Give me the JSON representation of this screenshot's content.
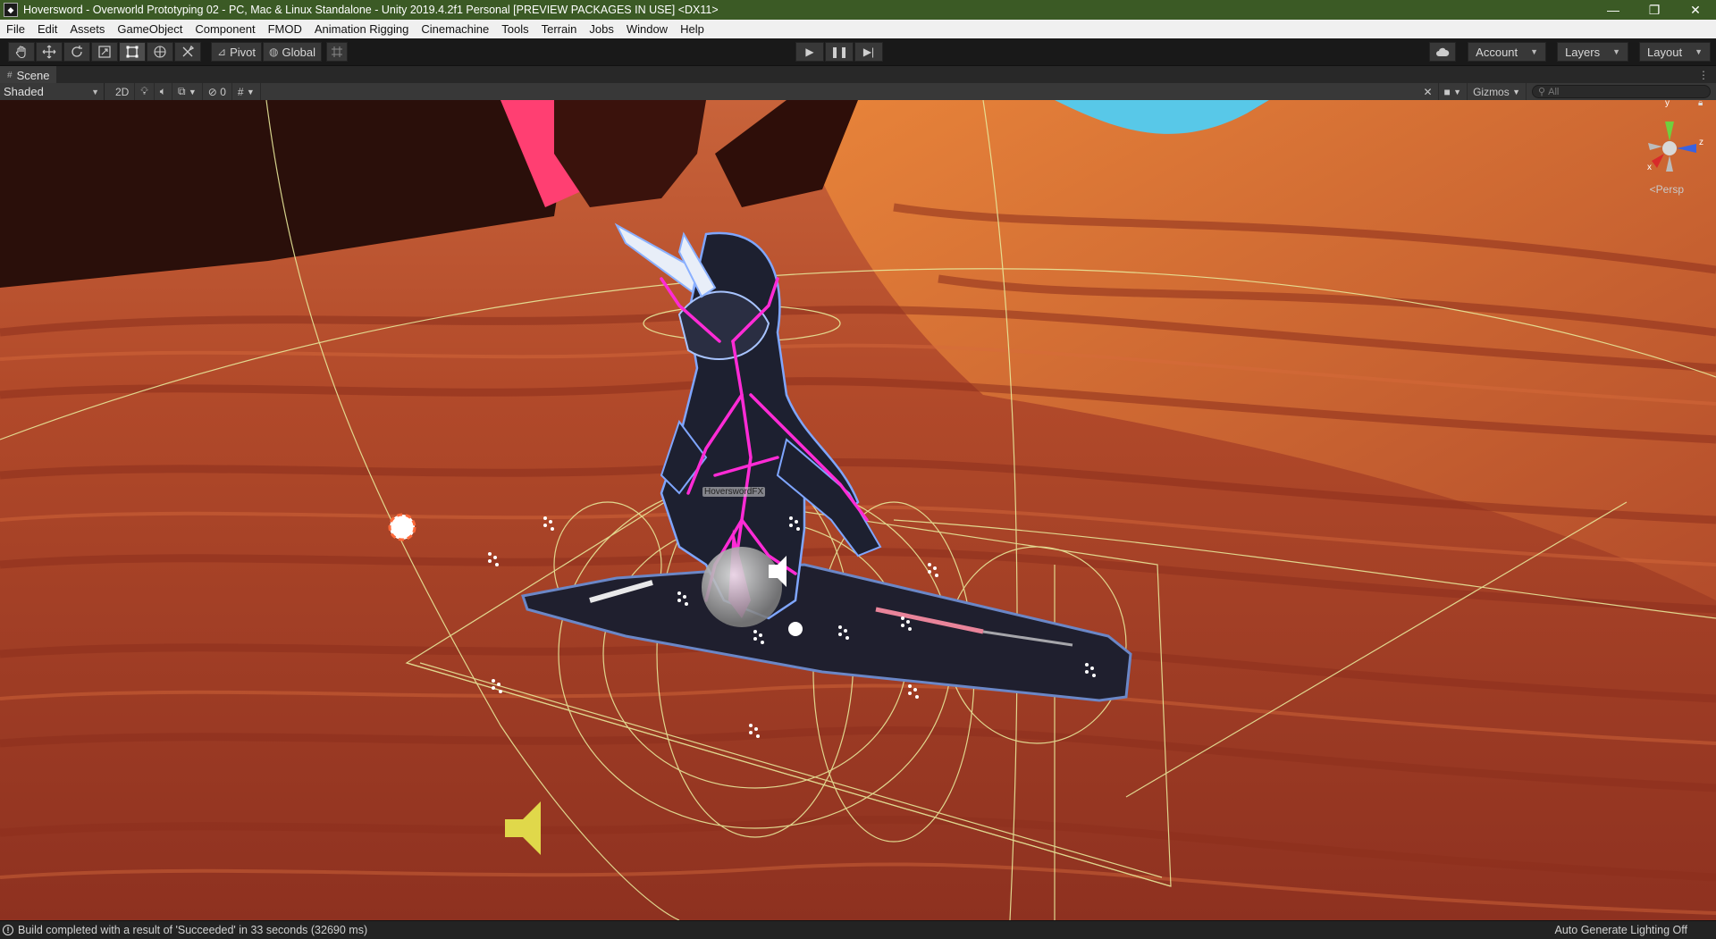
{
  "titlebar": {
    "title": "Hoversword - Overworld Prototyping 02 - PC, Mac & Linux Standalone - Unity 2019.4.2f1 Personal [PREVIEW PACKAGES IN USE] <DX11>",
    "minimize": "—",
    "maximize": "❐",
    "close": "✕"
  },
  "menu": [
    "File",
    "Edit",
    "Assets",
    "GameObject",
    "Component",
    "FMOD",
    "Animation Rigging",
    "Cinemachine",
    "Tools",
    "Terrain",
    "Jobs",
    "Window",
    "Help"
  ],
  "toolbar": {
    "tools": [
      "hand-icon",
      "move-icon",
      "rotate-icon",
      "scale-icon",
      "rect-icon",
      "transform-icon",
      "custom-tool-icon"
    ],
    "pivot_label": "Pivot",
    "global_label": "Global",
    "account_label": "Account",
    "layers_label": "Layers",
    "layout_label": "Layout"
  },
  "scene": {
    "tab_label": "Scene",
    "shading_mode": "Shaded",
    "two_d_label": "2D",
    "hidden_count": "0",
    "gizmos_label": "Gizmos",
    "search_placeholder": "All",
    "persp_label": "<Persp",
    "axis_y": "y",
    "axis_x": "x",
    "axis_z": "z",
    "object_label": "HoverswordFX"
  },
  "status": {
    "message": "Build completed with a result of 'Succeeded' in 33 seconds (32690 ms)",
    "right_text": "Auto Generate Lighting Off"
  },
  "colors": {
    "title_bar": "#3b5a25",
    "desert": "#b34c2b",
    "bones": "#ff2bd6",
    "gizmo_lines": "#e8e89a"
  }
}
